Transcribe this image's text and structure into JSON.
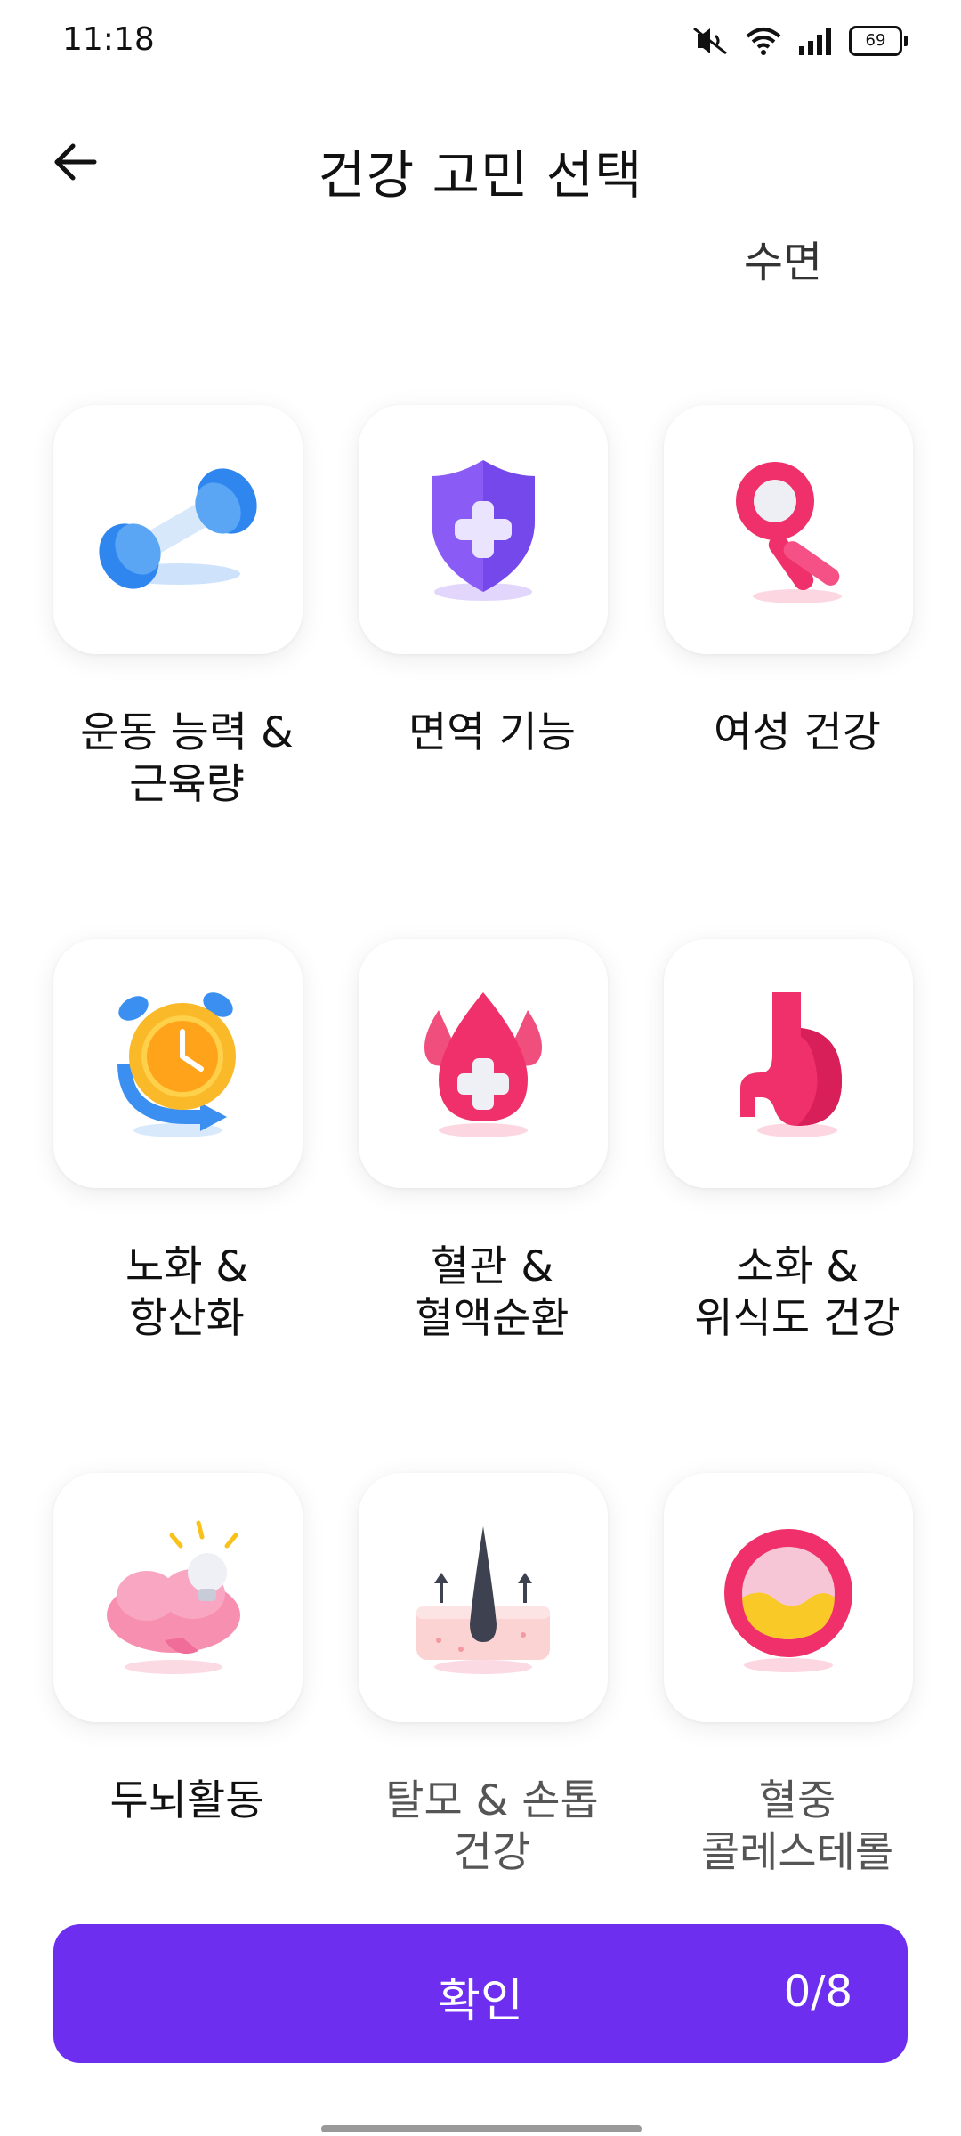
{
  "status_bar": {
    "time": "11:18",
    "battery": "69",
    "icons": [
      "mute-icon",
      "wifi-icon",
      "signal-icon",
      "battery-icon"
    ]
  },
  "header": {
    "title": "건강 고민 선택",
    "back_icon": "back-arrow-icon"
  },
  "partial_item_label": "수면",
  "tiles": [
    {
      "label": "운동 능력 &\n근육량",
      "icon": "dumbbell-icon"
    },
    {
      "label": "면역 기능",
      "icon": "shield-plus-icon"
    },
    {
      "label": "여성 건강",
      "icon": "female-symbol-icon"
    },
    {
      "label": "노화 &\n항산화",
      "icon": "alarm-clock-icon"
    },
    {
      "label": "혈관 &\n혈액순환",
      "icon": "blood-drop-icon"
    },
    {
      "label": "소화 &\n위식도 건강",
      "icon": "stomach-icon"
    },
    {
      "label": "두뇌활동",
      "icon": "brain-bulb-icon"
    },
    {
      "label": "탈모 & 손톱\n건강",
      "icon": "hair-follicle-icon"
    },
    {
      "label": "혈중\n콜레스테롤",
      "icon": "cholesterol-icon"
    }
  ],
  "confirm": {
    "label": "확인",
    "count": "0/8"
  },
  "colors": {
    "accent": "#6d2ef0",
    "pink": "#f0306a",
    "blue": "#3b8ff0",
    "purple": "#8a5cf5"
  }
}
